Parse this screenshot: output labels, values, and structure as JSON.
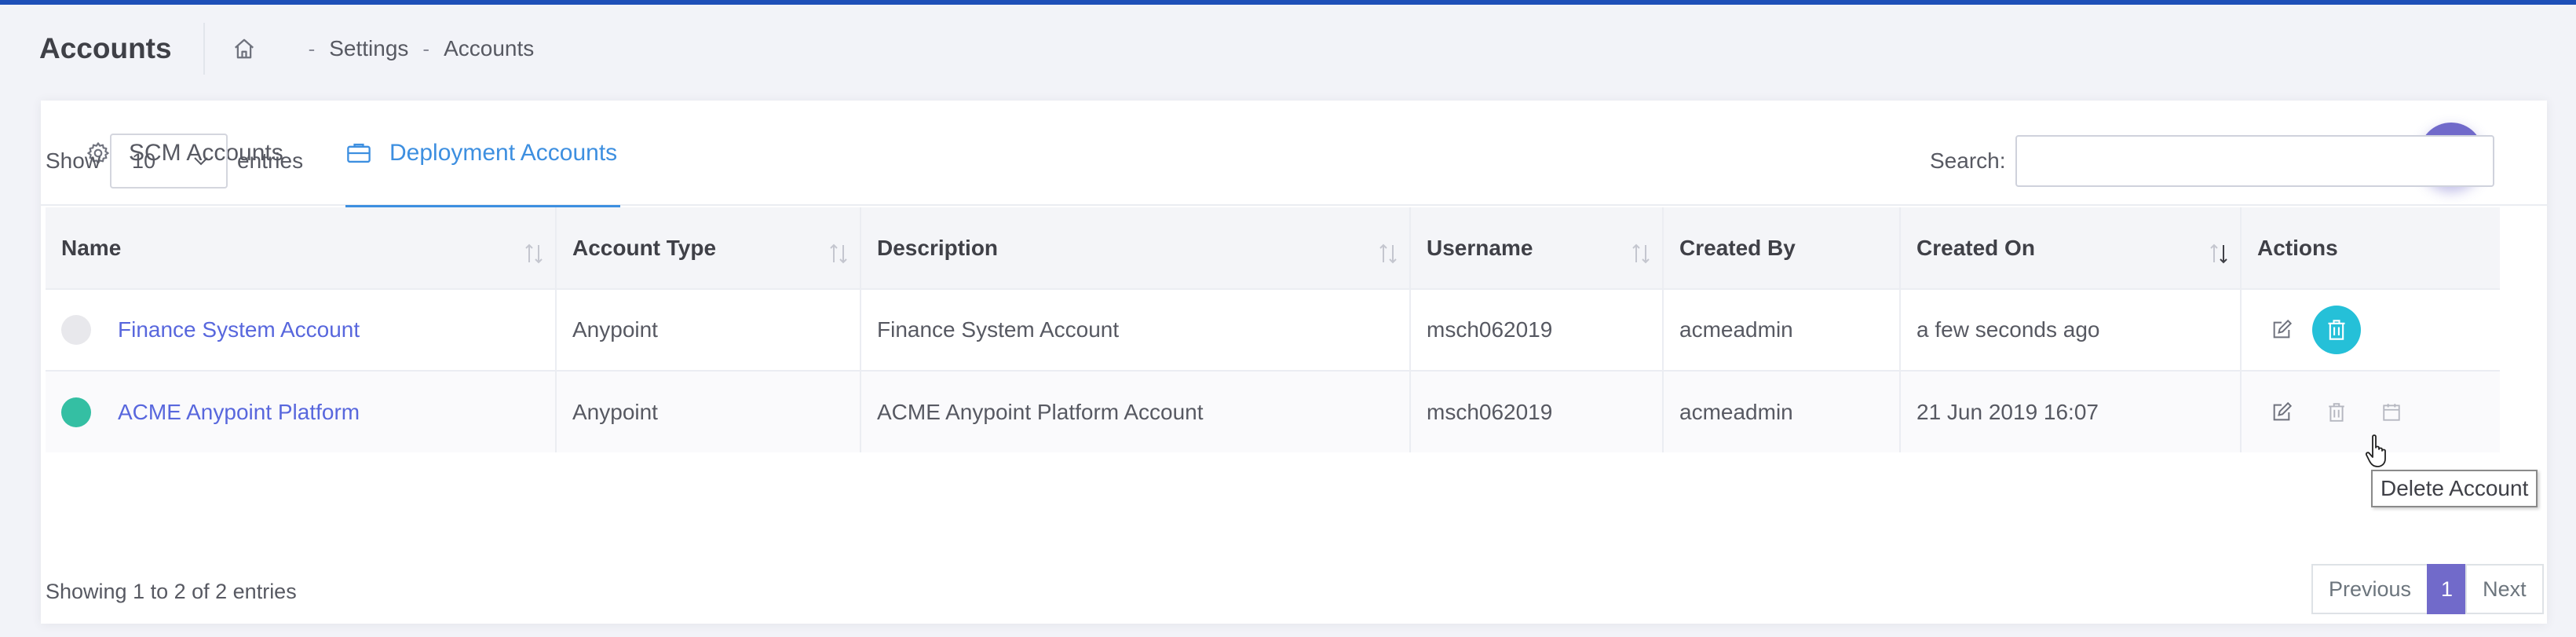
{
  "page": {
    "title": "Accounts"
  },
  "breadcrumb": {
    "items": [
      "Settings",
      "Accounts"
    ],
    "separator": "-"
  },
  "tabs": [
    {
      "label": "SCM Accounts",
      "icon": "gear-icon",
      "active": false
    },
    {
      "label": "Deployment Accounts",
      "icon": "briefcase-icon",
      "active": true
    }
  ],
  "controls": {
    "show_label": "Show",
    "page_size": "10",
    "entries_label": "entries",
    "search_label": "Search:",
    "search_value": ""
  },
  "table": {
    "columns": [
      "Name",
      "Account Type",
      "Description",
      "Username",
      "Created By",
      "Created On",
      "Actions"
    ],
    "rows": [
      {
        "status_color": "#e8e8ec",
        "name": "Finance System Account",
        "type": "Anypoint",
        "description": "Finance System Account",
        "username": "msch062019",
        "created_by": "acmeadmin",
        "created_on": "a few seconds ago"
      },
      {
        "status_color": "#34bfa3",
        "name": "ACME Anypoint Platform",
        "type": "Anypoint",
        "description": "ACME Anypoint Platform Account",
        "username": "msch062019",
        "created_by": "acmeadmin",
        "created_on": "21 Jun 2019 16:07"
      }
    ]
  },
  "tooltip": "Delete Account",
  "footer": {
    "info": "Showing 1 to 2 of 2 entries",
    "prev": "Previous",
    "current": "1",
    "next": "Next"
  },
  "colors": {
    "accent": "#716aca",
    "link": "#5867dd",
    "tab_active": "#3d8fe0",
    "delete_hover": "#25c0d8"
  }
}
